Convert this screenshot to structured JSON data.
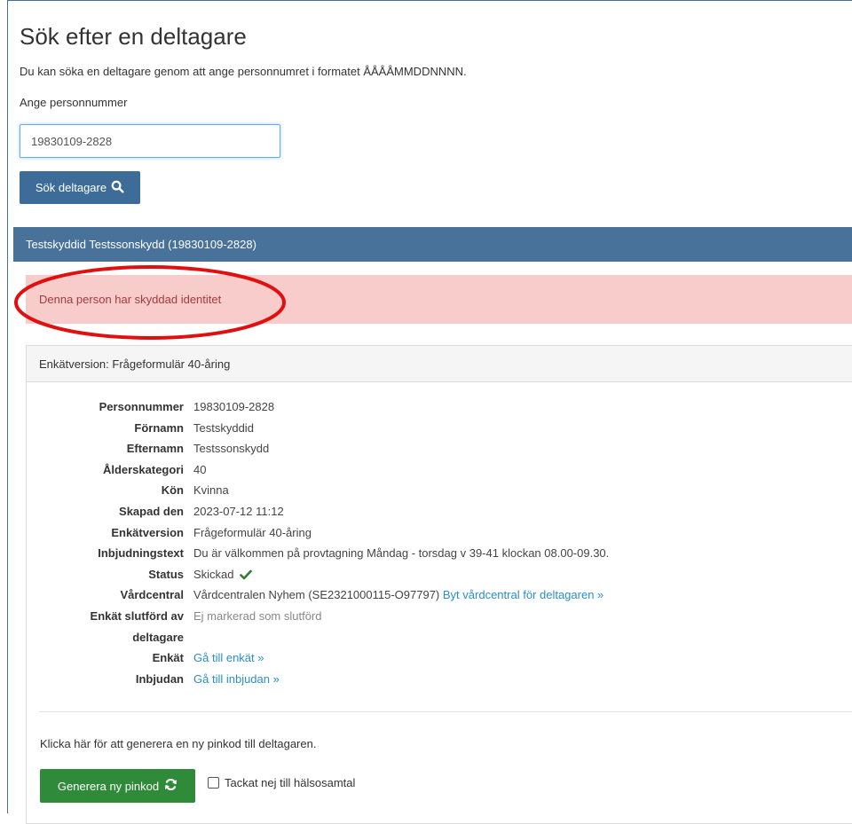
{
  "page": {
    "title": "Sök efter en deltagare",
    "description": "Du kan söka en deltagare genom att ange personnumret i formatet ÅÅÅÅMMDDNNNN.",
    "input_label": "Ange personnummer"
  },
  "search": {
    "value": "19830109-2828",
    "button_label": "Sök deltagare"
  },
  "result": {
    "panel_title": "Testskyddid Testssonskydd (19830109-2828)",
    "alert": "Denna person har skyddad identitet",
    "survey_header": "Enkätversion: Frågeformulär 40-åring",
    "fields": {
      "personnummer": {
        "key": "Personnummer",
        "value": "19830109-2828"
      },
      "fornamn": {
        "key": "Förnamn",
        "value": "Testskyddid"
      },
      "efternamn": {
        "key": "Efternamn",
        "value": "Testssonskydd"
      },
      "alder": {
        "key": "Ålderskategori",
        "value": "40"
      },
      "kon": {
        "key": "Kön",
        "value": "Kvinna"
      },
      "skapad": {
        "key": "Skapad den",
        "value": "2023-07-12 11:12"
      },
      "enkatversion": {
        "key": "Enkätversion",
        "value": "Frågeformulär 40-åring"
      },
      "inbjudningstext": {
        "key": "Inbjudningstext",
        "value": "Du är välkommen på provtagning Måndag - torsdag v 39-41 klockan 08.00-09.30."
      },
      "status": {
        "key": "Status",
        "value": "Skickad"
      },
      "vardcentral": {
        "key": "Vårdcentral",
        "value": "Vårdcentralen Nyhem (SE2321000115-O97797)",
        "link": "Byt vårdcentral för deltagaren »"
      },
      "slutford": {
        "key_line1": "Enkät slutförd av",
        "key_line2": "deltagare",
        "value": "Ej markerad som slutförd"
      },
      "enkat": {
        "key": "Enkät",
        "link": "Gå till enkät »"
      },
      "inbjudan": {
        "key": "Inbjudan",
        "link": "Gå till inbjudan »"
      }
    },
    "pin_text": "Klicka här för att generera en ny pinkod till deltagaren.",
    "pin_button": "Generera ny pinkod",
    "declined_label": "Tackat nej till hälsosamtal"
  },
  "colors": {
    "header": "#49729a",
    "button_primary": "#3c6c97",
    "button_success": "#2f8a3a",
    "alert_bg": "#f9cccc",
    "alert_text": "#a33a3a",
    "link": "#2a8fc5",
    "annotation": "#e01010"
  }
}
